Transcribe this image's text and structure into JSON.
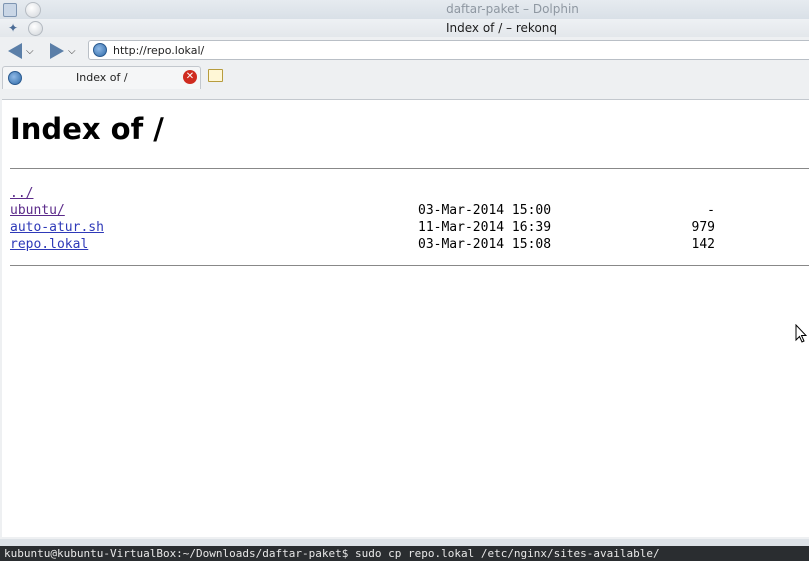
{
  "background_window": {
    "title": "daftar-paket – Dolphin"
  },
  "browser": {
    "window_title": "Index of / – rekonq",
    "url": "http://repo.lokal/",
    "tab": {
      "label": "Index of /"
    }
  },
  "page": {
    "heading": "Index of /",
    "entries": [
      {
        "name": "../",
        "date": "",
        "size": ""
      },
      {
        "name": "ubuntu/",
        "date": "03-Mar-2014 15:00",
        "size": "-"
      },
      {
        "name": "auto-atur.sh",
        "date": "11-Mar-2014 16:39",
        "size": "979"
      },
      {
        "name": "repo.lokal",
        "date": "03-Mar-2014 15:08",
        "size": "142"
      }
    ]
  },
  "terminal": {
    "line": "kubuntu@kubuntu-VirtualBox:~/Downloads/daftar-paket$ sudo cp repo.lokal /etc/nginx/sites-available/"
  },
  "colors": {
    "link": "#2e39b8",
    "visited_link": "#5b2a8a",
    "accent": "#5b7fa8"
  },
  "icons": [
    "app-menu-icon",
    "back-arrow-icon",
    "forward-arrow-icon",
    "globe-icon",
    "close-tab-icon",
    "new-tab-icon",
    "mouse-cursor-icon"
  ]
}
